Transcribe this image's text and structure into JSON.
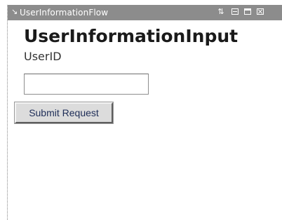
{
  "portlet": {
    "title": "UserInformationFlow",
    "controls": {
      "collapse_icon": "collapse-arrow-icon",
      "move_icon": "reorder-arrows-icon",
      "minimize_icon": "minimize-icon",
      "maximize_icon": "maximize-icon",
      "close_icon": "close-icon"
    }
  },
  "form": {
    "heading": "UserInformationInput",
    "userid_label": "UserID",
    "userid_value": "",
    "submit_label": "Submit Request"
  },
  "colors": {
    "titlebar_bg": "#8c8c8c",
    "titlebar_text": "#ffffff",
    "button_bg": "#dcdcdc",
    "button_text": "#1e2d57"
  }
}
